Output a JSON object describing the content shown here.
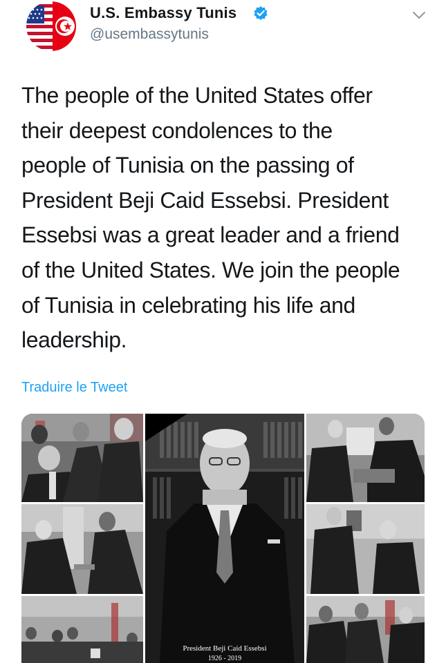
{
  "account": {
    "name": "U.S. Embassy Tunis",
    "handle": "@usembassytunis",
    "verified": true,
    "avatar_icon": "us-tunisia-flag-avatar",
    "menu_icon": "chevron-down-icon"
  },
  "tweet": {
    "text": "The people of the United States offer\ntheir deepest condolences to the\npeople of Tunisia on the passing of\nPresident Beji Caid Essebsi. President\nEssebsi was a great leader and a friend\nof the United States. We join the people\nof Tunisia in celebrating his life and\nleadership.",
    "translate_label": "Traduire le Tweet"
  },
  "media": {
    "caption_line1": "President Beji Caid Essebsi",
    "caption_line2": "1926 - 2019"
  },
  "colors": {
    "link": "#1da1f2",
    "verified": "#1da1f2",
    "handle": "#657786",
    "text": "#14171a"
  }
}
